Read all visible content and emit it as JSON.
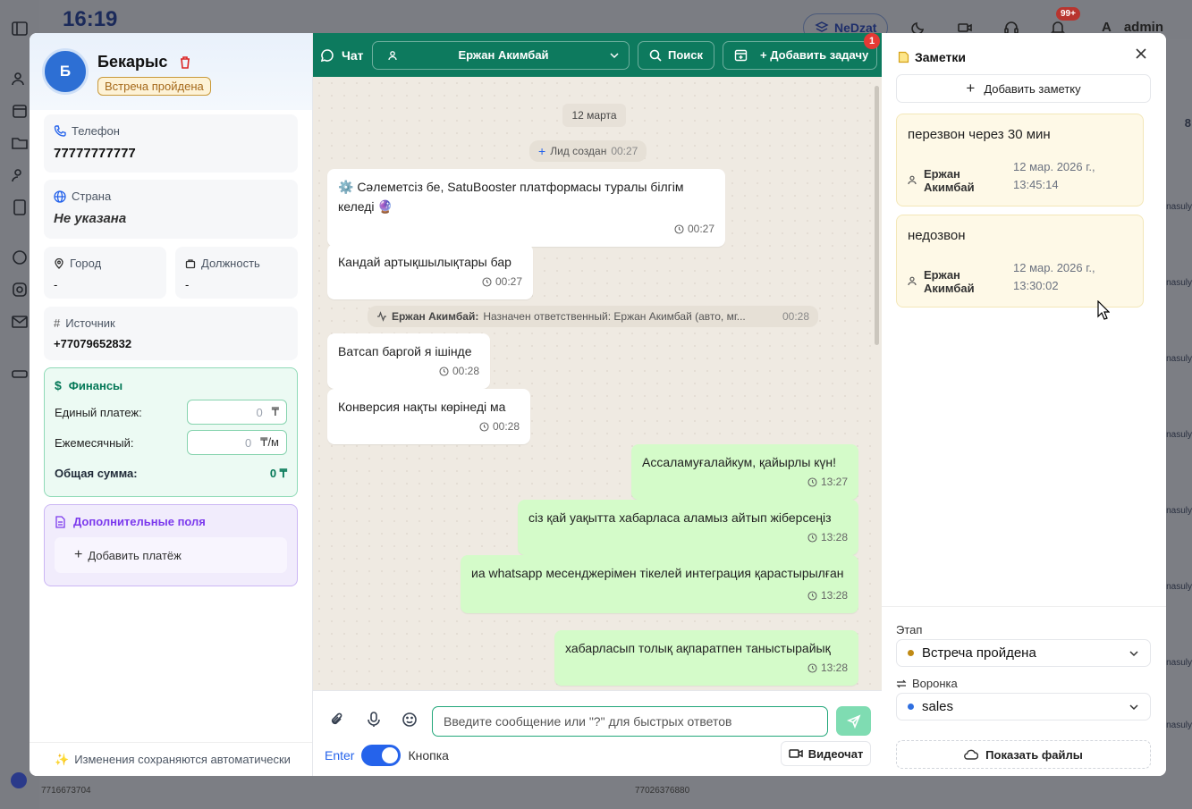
{
  "background": {
    "clock": "16:19",
    "project": "NeDzat",
    "notifications": "99+",
    "avatar_letter": "A",
    "user": "admin",
    "side_marks": [
      "8",
      "nasuly",
      "nasuly",
      "nasuly",
      "nasuly",
      "nasuly",
      "nasuly",
      "nasuly",
      "nasuly"
    ],
    "footer_phone": "7716673704",
    "footer_phone2": "77026376880"
  },
  "lead": {
    "avatar_letter": "Б",
    "name": "Бекарыс",
    "stage_badge": "Встреча пройдена",
    "phone_label": "Телефон",
    "phone": "77777777777",
    "country_label": "Страна",
    "country": "Не указана",
    "city_label": "Город",
    "city": "-",
    "position_label": "Должность",
    "position": "-",
    "source_label": "Источник",
    "source": "+77079652832",
    "finance": {
      "title": "Финансы",
      "single_label": "Единый платеж:",
      "single_value": "0",
      "single_cur": "₸",
      "monthly_label": "Ежемесячный:",
      "monthly_value": "0",
      "monthly_cur": "₸/м",
      "total_label": "Общая сумма:",
      "total": "0 ₸"
    },
    "extra_title": "Дополнительные поля",
    "add_payment": "Добавить платёж",
    "autosave": "Изменения сохраняются автоматически"
  },
  "chat": {
    "title": "Чат",
    "assignee": "Ержан Акимбай",
    "search": "Поиск",
    "add_task": "+ Добавить задачу",
    "add_task_badge": "1",
    "date": "12 марта",
    "sys1_text": "Лид создан",
    "sys1_time": "00:27",
    "sys2_author": "Ержан Акимбай:",
    "sys2_text": "Назначен ответственный: Ержан Акимбай (авто, мг...",
    "sys2_time": "00:28",
    "messages": [
      {
        "text": "⚙️ Сәлеметсіз бе, SatuBooster платформасы туралы білгім келеді 🔮",
        "time": "00:27"
      },
      {
        "text": "Кандай артықшылықтары бар",
        "time": "00:27"
      },
      {
        "text": "Ватсап баргой я ішінде",
        "time": "00:28"
      },
      {
        "text": "Конверсия нақты көрінеді ма",
        "time": "00:28"
      },
      {
        "text": "Ассаламуғалайкум, қайырлы күн!",
        "time": "13:27"
      },
      {
        "text": "сіз қай уақытта хабарласа аламыз айтып жіберсеңіз",
        "time": "13:28"
      },
      {
        "text": "иа whatsapp месенджерімен тікелей интеграция қарастырылған",
        "time": "13:28"
      },
      {
        "text": "хабарласып толық ақпаратпен таныстырайық",
        "time": "13:28"
      }
    ],
    "input_placeholder": "Введите сообщение или \"?\" для быстрых ответов",
    "enter_label": "Enter",
    "button_label": "Кнопка",
    "video": "Видеочат"
  },
  "notes": {
    "title": "Заметки",
    "add": "Добавить заметку",
    "items": [
      {
        "text": "перезвон через 30 мин",
        "author": "Ержан Акимбай",
        "date1": "12 мар. 2026 г.,",
        "date2": "13:45:14"
      },
      {
        "text": "недозвон",
        "author": "Ержан Акимбай",
        "date1": "12 мар. 2026 г.,",
        "date2": "13:30:02"
      }
    ],
    "stage_label": "Этап",
    "stage_value": "Встреча пройдена",
    "stage_color": "#c08a14",
    "funnel_label": "Воронка",
    "funnel_value": "sales",
    "funnel_color": "#2f6fe0",
    "files": "Показать файлы"
  }
}
